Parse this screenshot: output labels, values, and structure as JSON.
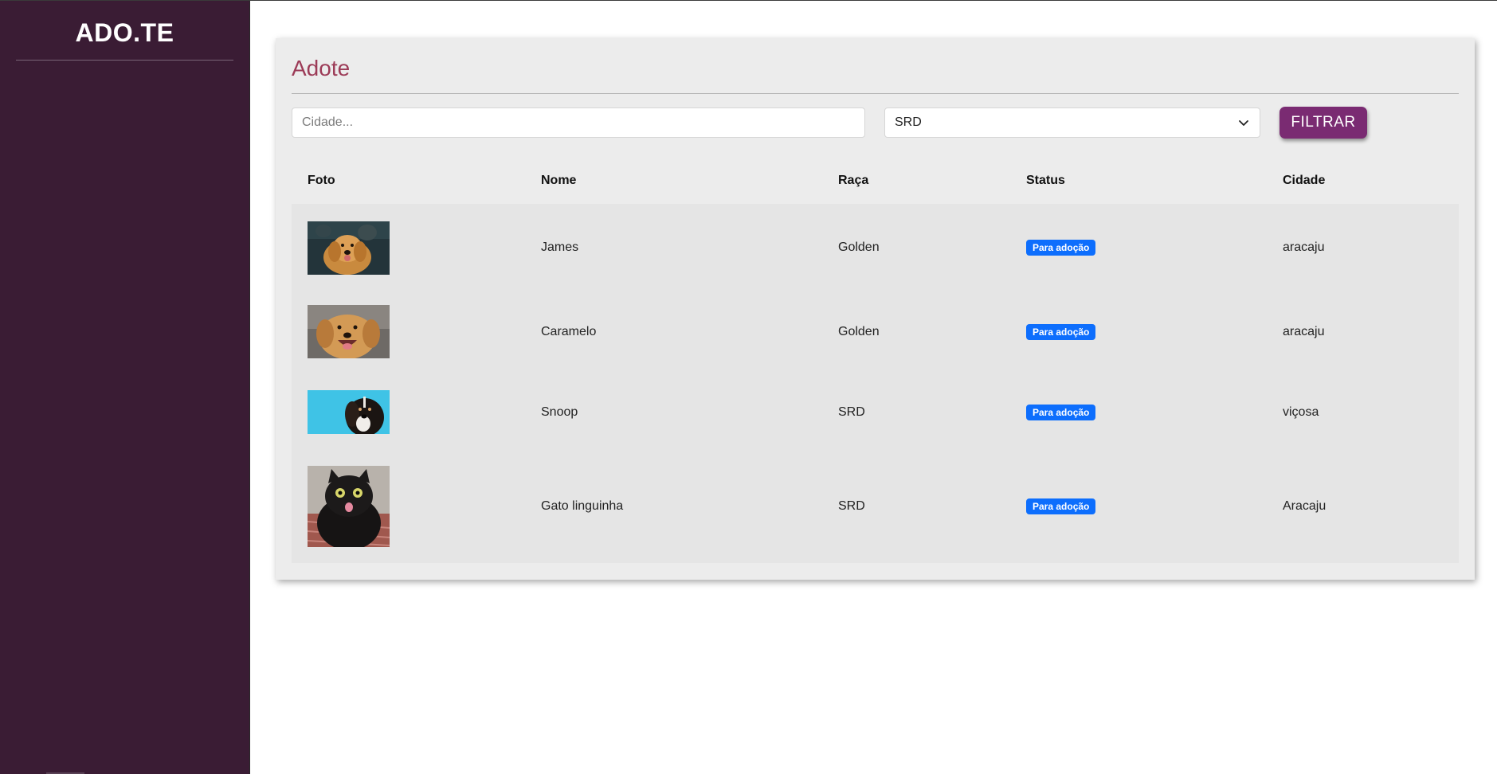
{
  "brand": "ADO.TE",
  "page": {
    "title": "Adote"
  },
  "filters": {
    "city_placeholder": "Cidade...",
    "city_value": "",
    "breed_selected": "SRD",
    "filter_label": "FILTRAR"
  },
  "table": {
    "headers": [
      "Foto",
      "Nome",
      "Raça",
      "Status",
      "Cidade"
    ],
    "rows": [
      {
        "photo": "golden-retriever-photo",
        "name": "James",
        "breed": "Golden",
        "status": "Para adoção",
        "city": "aracaju"
      },
      {
        "photo": "golden-retriever-smiling-photo",
        "name": "Caramelo",
        "breed": "Golden",
        "status": "Para adoção",
        "city": "aracaju"
      },
      {
        "photo": "black-white-dog-blue-background-photo",
        "name": "Snoop",
        "breed": "SRD",
        "status": "Para adoção",
        "city": "viçosa"
      },
      {
        "photo": "black-cat-tongue-out-photo",
        "name": "Gato linguinha",
        "breed": "SRD",
        "status": "Para adoção",
        "city": "Aracaju"
      }
    ]
  },
  "colors": {
    "sidebar": "#3a1c34",
    "title": "#9c3b57",
    "button": "#7a2b72",
    "badge": "#0d6efd"
  }
}
